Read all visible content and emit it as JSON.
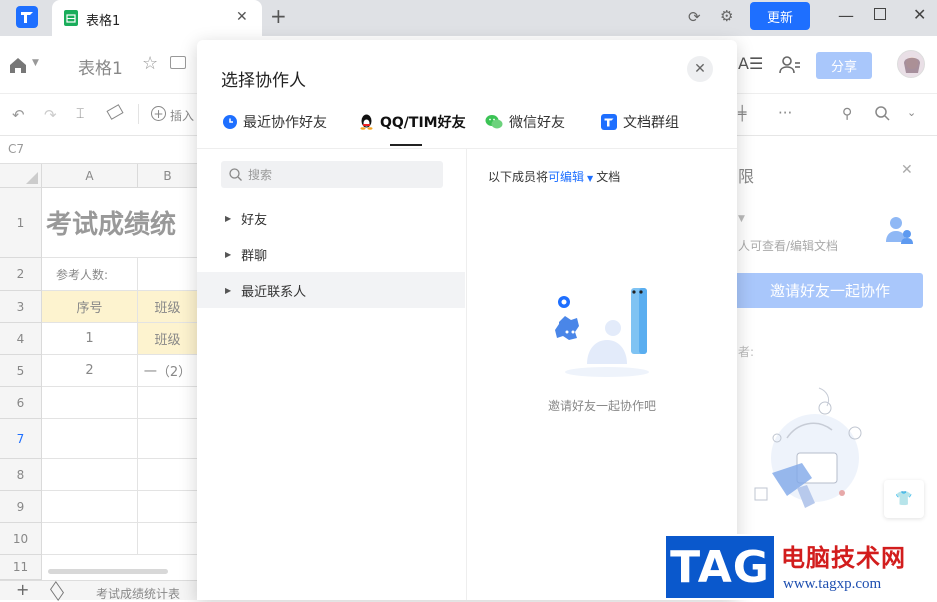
{
  "titlebar": {
    "tab_title": "表格1",
    "update_label": "更新"
  },
  "toolbar": {
    "doc_title": "表格1",
    "share_label": "分享",
    "insert_label": "插入"
  },
  "formula": {
    "cell_ref": "C7"
  },
  "grid": {
    "columns": [
      "A",
      "B"
    ],
    "rows": [
      "1",
      "2",
      "3",
      "4",
      "5",
      "6",
      "7",
      "8",
      "9",
      "10",
      "11"
    ],
    "title_cell": "考试成绩统",
    "count_label": "参考人数:",
    "header_a": "序号",
    "header_b": "班级",
    "r4a": "1",
    "r4b": "班级",
    "r5a": "2",
    "r5b": "一（2）"
  },
  "sheet_tab": "考试成绩统计表",
  "dialog": {
    "title": "选择协作人",
    "tabs": [
      "最近协作好友",
      "QQ/TIM好友",
      "微信好友",
      "文档群组"
    ],
    "search_placeholder": "搜索",
    "groups": [
      "好友",
      "群聊",
      "最近联系人"
    ],
    "note_prefix": "以下成员将",
    "note_perm": "可编辑",
    "note_suffix": "文档",
    "empty_text": "邀请好友一起协作吧"
  },
  "sidepanel": {
    "title_fragment": "限",
    "desc_fragment": "人可查看/编辑文档",
    "invite_label": "邀请好友一起协作",
    "fragment2": "者:"
  },
  "watermark": {
    "tag": "TAG",
    "cn": "电脑技术网",
    "url": "www.tagxp.com"
  },
  "colors": {
    "accent": "#1e6fff",
    "share_bg": "#a9c7fb",
    "header_fill": "#fdf3cf"
  }
}
